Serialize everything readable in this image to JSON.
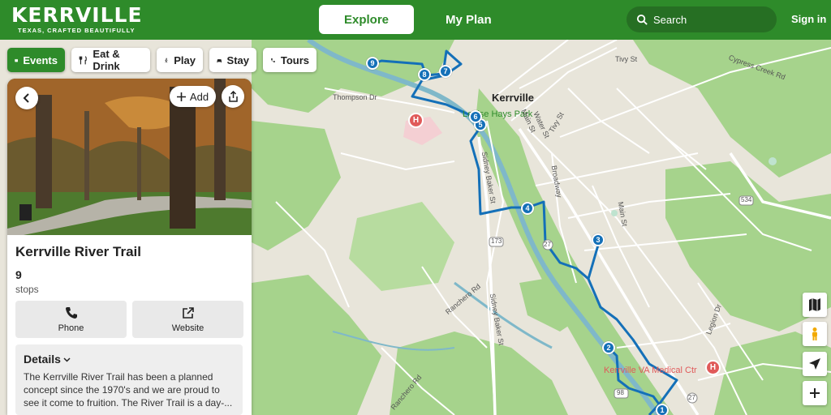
{
  "header": {
    "logo": "KERRVILLE",
    "tagline": "TEXAS, CRAFTED BEAUTIFULLY",
    "explore": "Explore",
    "my_plan": "My Plan",
    "search": "Search",
    "sign_in": "Sign in"
  },
  "chips": [
    {
      "label": "Events",
      "icon": "calendar-icon",
      "active": true
    },
    {
      "label": "Eat & Drink",
      "icon": "fork-knife-icon",
      "active": false
    },
    {
      "label": "Play",
      "icon": "hiker-icon",
      "active": false
    },
    {
      "label": "Stay",
      "icon": "bed-icon",
      "active": false
    },
    {
      "label": "Tours",
      "icon": "tours-icon",
      "active": false
    }
  ],
  "panel": {
    "add": "Add",
    "title": "Kerrville River Trail",
    "stops_count": "9",
    "stops_label": "stops",
    "phone": "Phone",
    "website": "Website",
    "details_heading": "Details",
    "details_text": "The Kerrville River Trail has been a planned concept since the 1970's and we are proud to see it come to fruition. The River Trail is a day-..."
  },
  "map": {
    "city": "Kerrville",
    "park": "Louise Hays Park",
    "hospital": "Kerrville VA Medical Ctr",
    "streets": [
      "Thompson Dr",
      "Main St",
      "Water St",
      "Tivy St",
      "Tivy St",
      "Cypress Creek Rd",
      "Broadway",
      "Main St",
      "Sidney Baker St",
      "Sidney Baker St",
      "Ranchero Rd",
      "Ranchero Rd",
      "Legion Dr",
      "173",
      "27",
      "534",
      "27",
      "98"
    ],
    "markers": [
      "1",
      "2",
      "3",
      "4",
      "5",
      "6",
      "7",
      "8",
      "9"
    ]
  },
  "colors": {
    "brand_green": "#2e8b2a",
    "route_blue": "#1470b8",
    "river": "#7fb8c9"
  }
}
